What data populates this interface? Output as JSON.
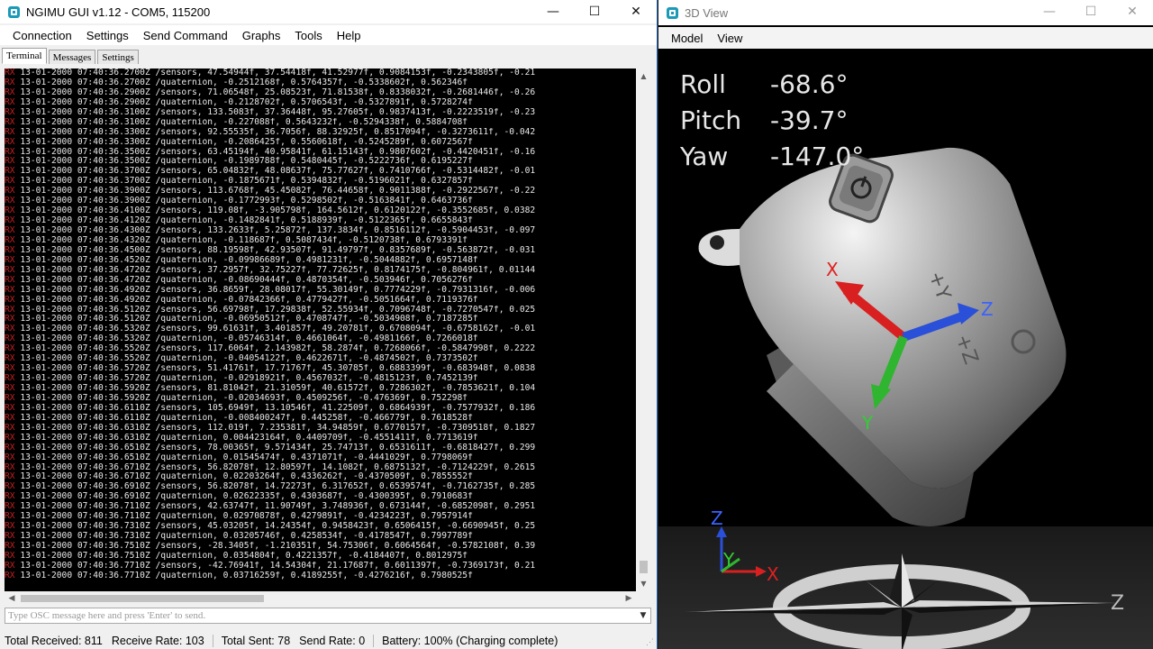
{
  "left_window": {
    "title": "NGIMU GUI v1.12 - COM5, 115200",
    "controls": {
      "minimize": "—",
      "maximize": "☐",
      "close": "✕"
    },
    "menu": [
      "Connection",
      "Settings",
      "Send Command",
      "Graphs",
      "Tools",
      "Help"
    ],
    "tabs": [
      "Terminal",
      "Messages",
      "Settings"
    ],
    "terminal_lines": [
      {
        "prefix": "RX",
        "text": " 13-01-2000 07:40:36.2700Z /sensors, 47.54944f, 37.54418f, 41.52977f, 0.9084153f, -0.2343805f, -0.21"
      },
      {
        "prefix": "RX",
        "text": " 13-01-2000 07:40:36.2700Z /quaternion, -0.2512168f, 0.5764357f, -0.5338602f, 0.562346f"
      },
      {
        "prefix": "RX",
        "text": " 13-01-2000 07:40:36.2900Z /sensors, 71.06548f, 25.08523f, 71.81538f, 0.8338032f, -0.2681446f, -0.26"
      },
      {
        "prefix": "RX",
        "text": " 13-01-2000 07:40:36.2900Z /quaternion, -0.2128702f, 0.5706543f, -0.5327891f, 0.5728274f"
      },
      {
        "prefix": "RX",
        "text": " 13-01-2000 07:40:36.3100Z /sensors, 133.5083f, 37.36448f, 95.27605f, 0.9837413f, -0.2223519f, -0.23"
      },
      {
        "prefix": "RX",
        "text": " 13-01-2000 07:40:36.3100Z /quaternion, -0.227088f, 0.5643232f, -0.5294338f, 0.5884708f"
      },
      {
        "prefix": "RX",
        "text": " 13-01-2000 07:40:36.3300Z /sensors, 92.55535f, 36.7056f, 88.32925f, 0.8517094f, -0.3273611f, -0.042"
      },
      {
        "prefix": "RX",
        "text": " 13-01-2000 07:40:36.3300Z /quaternion, -0.2086425f, 0.5560618f, -0.5245289f, 0.6072567f"
      },
      {
        "prefix": "RX",
        "text": " 13-01-2000 07:40:36.3500Z /sensors, 63.45194f, 40.95841f, 61.15143f, 0.9807602f, -0.4420451f, -0.16"
      },
      {
        "prefix": "RX",
        "text": " 13-01-2000 07:40:36.3500Z /quaternion, -0.1989788f, 0.5480445f, -0.5222736f, 0.6195227f"
      },
      {
        "prefix": "RX",
        "text": " 13-01-2000 07:40:36.3700Z /sensors, 65.04832f, 48.08637f, 75.77627f, 0.7410766f, -0.5314482f, -0.01"
      },
      {
        "prefix": "RX",
        "text": " 13-01-2000 07:40:36.3700Z /quaternion, -0.1875671f, 0.5394832f, -0.5196021f, 0.6327857f"
      },
      {
        "prefix": "RX",
        "text": " 13-01-2000 07:40:36.3900Z /sensors, 113.6768f, 45.45082f, 76.44658f, 0.9011388f, -0.2922567f, -0.22"
      },
      {
        "prefix": "RX",
        "text": " 13-01-2000 07:40:36.3900Z /quaternion, -0.1772993f, 0.5298502f, -0.5163841f, 0.6463736f"
      },
      {
        "prefix": "RX",
        "text": " 13-01-2000 07:40:36.4100Z /sensors, 119.08f, -3.905798f, 164.5612f, 0.6120122f, -0.3552685f, 0.0382"
      },
      {
        "prefix": "RX",
        "text": " 13-01-2000 07:40:36.4120Z /quaternion, -0.1482841f, 0.5188939f, -0.5122365f, 0.6655843f"
      },
      {
        "prefix": "RX",
        "text": " 13-01-2000 07:40:36.4300Z /sensors, 133.2633f, 5.25872f, 137.3834f, 0.8516112f, -0.5904453f, -0.097"
      },
      {
        "prefix": "RX",
        "text": " 13-01-2000 07:40:36.4320Z /quaternion, -0.118687f, 0.5087434f, -0.5120738f, 0.6793391f"
      },
      {
        "prefix": "RX",
        "text": " 13-01-2000 07:40:36.4500Z /sensors, 88.19598f, 42.93507f, 91.49797f, 0.8357689f, -0.563872f, -0.031"
      },
      {
        "prefix": "RX",
        "text": " 13-01-2000 07:40:36.4520Z /quaternion, -0.09986689f, 0.4981231f, -0.5044882f, 0.6957148f"
      },
      {
        "prefix": "RX",
        "text": " 13-01-2000 07:40:36.4720Z /sensors, 37.2957f, 32.75227f, 77.72625f, 0.8174175f, -0.804961f, 0.01144"
      },
      {
        "prefix": "RX",
        "text": " 13-01-2000 07:40:36.4720Z /quaternion, -0.08690444f, 0.4870354f, -0.503946f, 0.7056276f"
      },
      {
        "prefix": "RX",
        "text": " 13-01-2000 07:40:36.4920Z /sensors, 36.8659f, 28.08017f, 55.30149f, 0.7774229f, -0.7931316f, -0.006"
      },
      {
        "prefix": "RX",
        "text": " 13-01-2000 07:40:36.4920Z /quaternion, -0.07842366f, 0.4779427f, -0.5051664f, 0.7119376f"
      },
      {
        "prefix": "RX",
        "text": " 13-01-2000 07:40:36.5120Z /sensors, 56.69798f, 17.29838f, 52.55934f, 0.7096748f, -0.7270547f, 0.025"
      },
      {
        "prefix": "RX",
        "text": " 13-01-2000 07:40:36.5120Z /quaternion, -0.06950512f, 0.4708747f, -0.5034908f, 0.7187285f"
      },
      {
        "prefix": "RX",
        "text": " 13-01-2000 07:40:36.5320Z /sensors, 99.61631f, 3.401857f, 49.20781f, 0.6708094f, -0.6758162f, -0.01"
      },
      {
        "prefix": "RX",
        "text": " 13-01-2000 07:40:36.5320Z /quaternion, -0.05746314f, 0.4661064f, -0.4981166f, 0.7266018f"
      },
      {
        "prefix": "RX",
        "text": " 13-01-2000 07:40:36.5520Z /sensors, 117.6064f, 2.143982f, 58.2874f, 0.7268066f, -0.5847998f, 0.2222"
      },
      {
        "prefix": "RX",
        "text": " 13-01-2000 07:40:36.5520Z /quaternion, -0.04054122f, 0.4622671f, -0.4874502f, 0.7373502f"
      },
      {
        "prefix": "RX",
        "text": " 13-01-2000 07:40:36.5720Z /sensors, 51.41761f, 17.71767f, 45.30785f, 0.6883399f, -0.683948f, 0.0838"
      },
      {
        "prefix": "RX",
        "text": " 13-01-2000 07:40:36.5720Z /quaternion, -0.02918921f, 0.4567032f, -0.4815123f, 0.7452139f"
      },
      {
        "prefix": "RX",
        "text": " 13-01-2000 07:40:36.5920Z /sensors, 81.81042f, 21.31059f, 40.61572f, 0.7286302f, -0.7853621f, 0.104"
      },
      {
        "prefix": "RX",
        "text": " 13-01-2000 07:40:36.5920Z /quaternion, -0.02034693f, 0.4509256f, -0.476369f, 0.752298f"
      },
      {
        "prefix": "RX",
        "text": " 13-01-2000 07:40:36.6110Z /sensors, 105.6949f, 13.10546f, 41.22509f, 0.6864939f, -0.7577932f, 0.186"
      },
      {
        "prefix": "RX",
        "text": " 13-01-2000 07:40:36.6110Z /quaternion, -0.008400247f, 0.445258f, -0.466779f, 0.7618528f"
      },
      {
        "prefix": "RX",
        "text": " 13-01-2000 07:40:36.6310Z /sensors, 112.019f, 7.235381f, 34.94859f, 0.6770157f, -0.7309518f, 0.1827"
      },
      {
        "prefix": "RX",
        "text": " 13-01-2000 07:40:36.6310Z /quaternion, 0.004423164f, 0.4409709f, -0.4551411f, 0.7713619f"
      },
      {
        "prefix": "RX",
        "text": " 13-01-2000 07:40:36.6510Z /sensors, 78.00365f, 9.571434f, 25.74713f, 0.6531611f, -0.6818427f, 0.299"
      },
      {
        "prefix": "RX",
        "text": " 13-01-2000 07:40:36.6510Z /quaternion, 0.01545474f, 0.4371071f, -0.4441029f, 0.7798069f"
      },
      {
        "prefix": "RX",
        "text": " 13-01-2000 07:40:36.6710Z /sensors, 56.82078f, 12.80597f, 14.1082f, 0.6875132f, -0.7124229f, 0.2615"
      },
      {
        "prefix": "RX",
        "text": " 13-01-2000 07:40:36.6710Z /quaternion, 0.02203264f, 0.4336262f, -0.4370509f, 0.7855552f"
      },
      {
        "prefix": "RX",
        "text": " 13-01-2000 07:40:36.6910Z /sensors, 56.82078f, 14.72273f, 6.317652f, 0.6539574f, -0.7162735f, 0.285"
      },
      {
        "prefix": "RX",
        "text": " 13-01-2000 07:40:36.6910Z /quaternion, 0.02622335f, 0.4303687f, -0.4300395f, 0.7910683f"
      },
      {
        "prefix": "RX",
        "text": " 13-01-2000 07:40:36.7110Z /sensors, 42.63747f, 11.90749f, 3.748936f, 0.673144f, -0.6852098f, 0.2951"
      },
      {
        "prefix": "RX",
        "text": " 13-01-2000 07:40:36.7110Z /quaternion, 0.02970878f, 0.4279891f, -0.4234223f, 0.7957914f"
      },
      {
        "prefix": "RX",
        "text": " 13-01-2000 07:40:36.7310Z /sensors, 45.03205f, 14.24354f, 0.9458423f, 0.6506415f, -0.6690945f, 0.25"
      },
      {
        "prefix": "RX",
        "text": " 13-01-2000 07:40:36.7310Z /quaternion, 0.03205746f, 0.4258534f, -0.4178547f, 0.7997789f"
      },
      {
        "prefix": "RX",
        "text": " 13-01-2000 07:40:36.7510Z /sensors, -28.3405f, -1.210351f, 54.75306f, 0.6064564f, -0.5782108f, 0.39"
      },
      {
        "prefix": "RX",
        "text": " 13-01-2000 07:40:36.7510Z /quaternion, 0.0354804f, 0.4221357f, -0.4184407f, 0.8012975f"
      },
      {
        "prefix": "RX",
        "text": " 13-01-2000 07:40:36.7710Z /sensors, -42.76941f, 14.54304f, 21.17687f, 0.6011397f, -0.7369173f, 0.21"
      },
      {
        "prefix": "RX",
        "text": " 13-01-2000 07:40:36.7710Z /quaternion, 0.03716259f, 0.4189255f, -0.4276216f, 0.7980525f"
      }
    ],
    "osc_placeholder": "Type OSC message here and press 'Enter' to send.",
    "status": {
      "total_received": "Total Received: 811",
      "receive_rate": "Receive Rate: 103",
      "total_sent": "Total Sent: 78",
      "send_rate": "Send Rate: 0",
      "battery": "Battery: 100%  (Charging complete)"
    }
  },
  "right_window": {
    "title": "3D View",
    "menu": [
      "Model",
      "View"
    ],
    "angles": [
      {
        "label": "Roll",
        "value": "-68.6°"
      },
      {
        "label": "Pitch",
        "value": "-39.7°"
      },
      {
        "label": "Yaw",
        "value": "-147.0°"
      }
    ],
    "axis_labels": {
      "x": "X",
      "y": "Y",
      "z": "Z"
    },
    "colors": {
      "x_axis": "#d92020",
      "y_axis": "#2fb52f",
      "z_axis": "#2a4fd8",
      "rx_prefix": "#c41f1f"
    },
    "icons": [
      "power-button-icon",
      "compass-rose-icon"
    ]
  }
}
